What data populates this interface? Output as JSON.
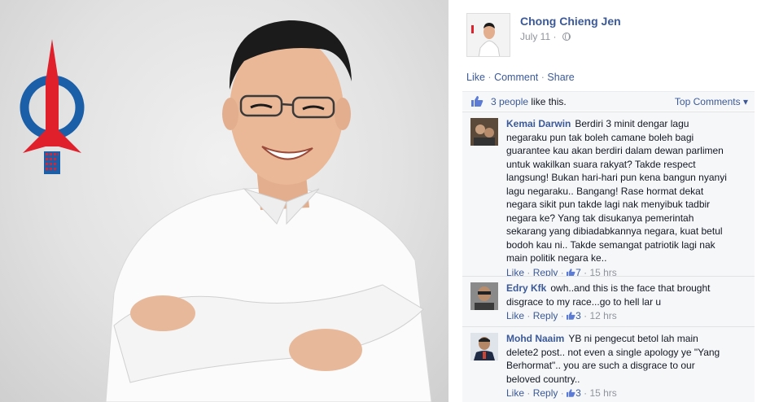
{
  "post": {
    "author": "Chong Chieng Jen",
    "date": "July 11",
    "privacy_icon": "globe-icon"
  },
  "actions": {
    "like": "Like",
    "comment": "Comment",
    "share": "Share",
    "separator": "·"
  },
  "likes": {
    "count_text": "3 people",
    "suffix": " like this.",
    "sort_label": "Top Comments",
    "sort_caret": "▾"
  },
  "comments": [
    {
      "name": "Kemai Darwin",
      "lines": [
        "Berdiri 3 minit dengar lagu",
        "negaraku pun tak boleh camane boleh bagi",
        "guarantee kau akan berdiri dalam dewan parlimen",
        "untuk wakilkan suara rakyat? Takde respect",
        "langsung! Bukan hari-hari pun kena bangun nyanyi",
        "lagu negaraku.. Bangang! Rase hormat dekat",
        "negara sikit pun takde lagi nak menyibuk tadbir",
        "negara ke? Yang tak disukanya pemerintah",
        "sekarang yang dibiadabkannya negara, kuat betul",
        "bodoh kau ni.. Takde semangat patriotik lagi nak",
        "main politik negara ke.."
      ],
      "like": "Like",
      "reply": "Reply",
      "likes": "7",
      "time": "15 hrs"
    },
    {
      "name": "Edry Kfk",
      "lines": [
        "owh..and this is the face that brought",
        "disgrace to my race...go to hell lar u"
      ],
      "like": "Like",
      "reply": "Reply",
      "likes": "3",
      "time": "12 hrs"
    },
    {
      "name": "Mohd Naaim",
      "lines": [
        "YB ni pengecut betol lah main",
        "delete2 post.. not even a single apology ye \"Yang",
        "Berhormat\".. you are such a disgrace to our",
        "beloved country.."
      ],
      "like": "Like",
      "reply": "Reply",
      "likes": "3",
      "time": "15 hrs"
    }
  ],
  "colors": {
    "link": "#3b5998",
    "muted": "#90949c",
    "logo_red": "#e0202a",
    "logo_blue": "#1a5fa8"
  }
}
